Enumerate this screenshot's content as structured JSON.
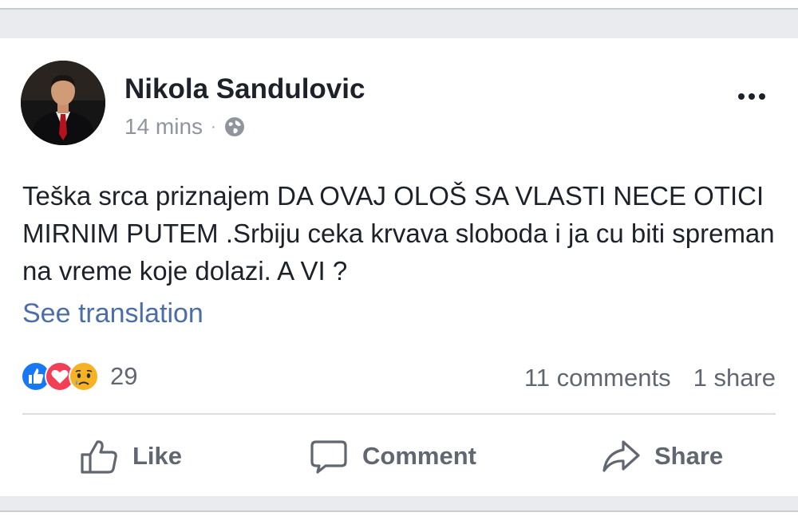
{
  "post": {
    "author": "Nikola Sandulovic",
    "time": "14 mins",
    "separator": "·",
    "privacy_icon": "globe-icon",
    "text": "Teška srca priznajem DA OVAJ OLOŠ SA VLASTI NECE OTICI MIRNIM PUTEM .Srbiju ceka krvava sloboda i ja cu biti spreman na vreme koje dolazi. A VI ?",
    "see_translation": "See translation"
  },
  "reactions": {
    "icons": [
      "like-reaction-icon",
      "love-reaction-icon",
      "sad-reaction-icon"
    ],
    "count": "29",
    "comments": "11 comments",
    "shares": "1 share"
  },
  "actions": {
    "like": "Like",
    "comment": "Comment",
    "share": "Share"
  },
  "colors": {
    "background": "#e9ebee",
    "card": "#ffffff",
    "author_text": "#1d2129",
    "meta_text": "#90949c",
    "link": "#4b6ea9",
    "like_blue": "#1877f2",
    "love_red": "#f33e58",
    "sad_yellow": "#f7b125"
  }
}
